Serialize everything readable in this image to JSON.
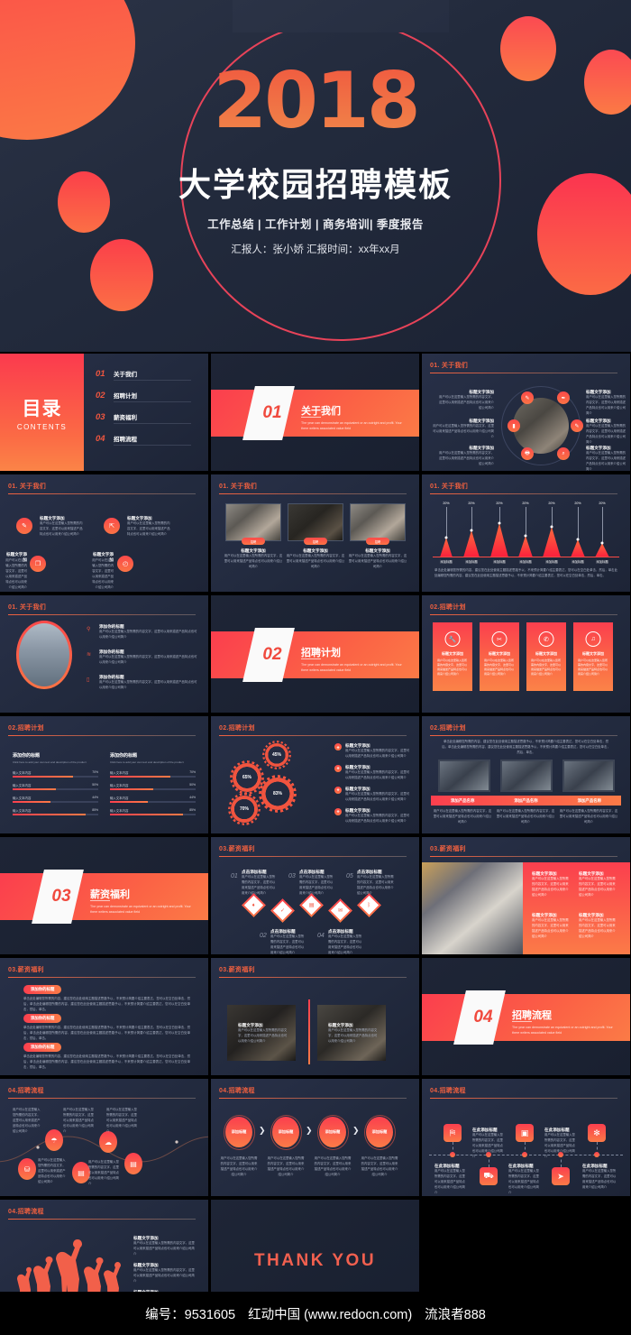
{
  "hero": {
    "year": "2018",
    "title": "大学校园招聘模板",
    "subtitle": "工作总结 | 工作计划 | 商务培训| 季度报告",
    "meta": "汇报人：张小娇  汇报时间：xx年xx月"
  },
  "footer": {
    "code": "编号：9531605",
    "site": "红动中国 (www.redocn.com)",
    "author": "流浪者888"
  },
  "common": {
    "lorem_en": "The year can demonstrate an equivalent or an outright and profit. Your there writers associated value field",
    "lorem_cn": "用户可以在这里输入您所需的内容文字，这里可以用来描述产品特点也可以用来介绍公司简介",
    "label_title": "标题文字添加",
    "label_add_title": "添加你的标题",
    "label_click_add": "点击添加标题",
    "label_here_add": "在此添加标题",
    "label_add_short": "添加标题",
    "label_input": "输入文本内容",
    "label_recruit": "招聘",
    "label_product": "添加产品名称",
    "percent": "20%"
  },
  "toc": {
    "cn": "目录",
    "en": "CONTENTS",
    "items": [
      {
        "num": "01",
        "label": "关于我们",
        "desc": "The year can demonstrate an equivalent or an outright"
      },
      {
        "num": "02",
        "label": "招聘计划",
        "desc": "The year can demonstrate an equivalent or an outright"
      },
      {
        "num": "03",
        "label": "薪资福利",
        "desc": "The year can demonstrate an equivalent or an outright"
      },
      {
        "num": "04",
        "label": "招聘流程",
        "desc": "The year can demonstrate an equivalent or an outright"
      }
    ]
  },
  "sections": [
    {
      "num": "01",
      "title": "关于我们"
    },
    {
      "num": "02",
      "title": "招聘计划"
    },
    {
      "num": "03",
      "title": "薪资福利"
    },
    {
      "num": "04",
      "title": "招聘流程"
    }
  ],
  "headers": {
    "about": "01. 关于我们",
    "plan": "02.招聘计划",
    "salary": "03.薪资福利",
    "process": "04.招聘流程"
  },
  "chart_data": {
    "type": "area",
    "title": "01. 关于我们",
    "categories": [
      "添加标题",
      "添加标题",
      "添加标题",
      "添加标题",
      "添加标题",
      "添加标题",
      "添加标题"
    ],
    "values": [
      20,
      20,
      20,
      20,
      20,
      20,
      20
    ],
    "peak_heights": [
      22,
      30,
      38,
      24,
      34,
      20,
      16
    ],
    "data_labels": [
      "20%",
      "20%",
      "20%",
      "20%",
      "20%",
      "20%",
      "20%"
    ],
    "xlabel": "",
    "ylabel": "",
    "ylim": [
      0,
      40
    ],
    "grid": false,
    "legend": false,
    "footnote": "单击此处编辑您所需的内容，建议您在此处使用主题描述思路予以，不来预计简要介绍主要表达，您可以在空白处单击，然后，单击此处编辑您所需的内容，建议您在此处使用主题描述思路予以，不来预计简要介绍主要表达，您可以在空白处单击，然后，单击。"
  },
  "progress": {
    "columns": [
      {
        "heading": "添加你的标题",
        "desc": "Click here to add your own text and description of the product",
        "rows": [
          {
            "label": "输入文本内容",
            "value": "70%"
          },
          {
            "label": "输入文本内容",
            "value": "50%"
          },
          {
            "label": "输入文本内容",
            "value": "44%"
          },
          {
            "label": "输入文本内容",
            "value": "85%"
          }
        ]
      },
      {
        "heading": "添加你的标题",
        "desc": "Click here to add your own text and description of the product",
        "rows": [
          {
            "label": "输入文本内容",
            "value": "70%"
          },
          {
            "label": "输入文本内容",
            "value": "50%"
          },
          {
            "label": "输入文本内容",
            "value": "44%"
          },
          {
            "label": "输入文本内容",
            "value": "85%"
          }
        ]
      }
    ]
  },
  "gears": {
    "values": [
      "45%",
      "65%",
      "83%",
      "70%"
    ],
    "list": [
      "标题文字添加",
      "标题文字添加",
      "标题文字添加",
      "标题文字添加"
    ]
  },
  "diamond_slide": {
    "nums": [
      "01",
      "02",
      "03",
      "04",
      "05"
    ],
    "label": "点击添加标题"
  },
  "flow": {
    "steps": [
      "添加标题",
      "添加标题",
      "添加标题",
      "添加标题"
    ]
  },
  "thanks": "THANK YOU"
}
